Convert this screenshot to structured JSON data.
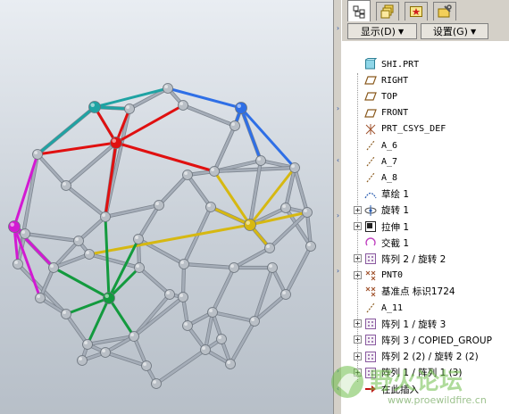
{
  "panel": {
    "tabs": [
      {
        "name": "model-tree-tab"
      },
      {
        "name": "layers-tab"
      },
      {
        "name": "favorites-tab"
      },
      {
        "name": "properties-tab"
      }
    ],
    "show_label": "显示(D)",
    "settings_label": "设置(G)"
  },
  "tree": {
    "items": [
      {
        "label": "SHI.PRT",
        "icon": "part-icon",
        "expandable": false
      },
      {
        "label": "RIGHT",
        "icon": "datum-plane-icon",
        "expandable": false
      },
      {
        "label": "TOP",
        "icon": "datum-plane-icon",
        "expandable": false
      },
      {
        "label": "FRONT",
        "icon": "datum-plane-icon",
        "expandable": false
      },
      {
        "label": "PRT_CSYS_DEF",
        "icon": "csys-icon",
        "expandable": false
      },
      {
        "label": "A_6",
        "icon": "datum-axis-icon",
        "expandable": false
      },
      {
        "label": "A_7",
        "icon": "datum-axis-icon",
        "expandable": false
      },
      {
        "label": "A_8",
        "icon": "datum-axis-icon",
        "expandable": false
      },
      {
        "label": "草绘 1",
        "icon": "sketch-icon",
        "expandable": false
      },
      {
        "label": "旋转 1",
        "icon": "revolve-icon",
        "expandable": true
      },
      {
        "label": "拉伸 1",
        "icon": "extrude-icon",
        "expandable": true
      },
      {
        "label": "交截 1",
        "icon": "intersect-icon",
        "expandable": false
      },
      {
        "label": "阵列 2 / 旋转 2",
        "icon": "pattern-icon",
        "expandable": true
      },
      {
        "label": "PNT0",
        "icon": "datum-point-icon",
        "expandable": true
      },
      {
        "label": "基准点 标识1724",
        "icon": "datum-point-icon",
        "expandable": false
      },
      {
        "label": "A_11",
        "icon": "datum-axis-icon",
        "expandable": false
      },
      {
        "label": "阵列 1 / 旋转 3",
        "icon": "pattern-icon",
        "expandable": true
      },
      {
        "label": "阵列 3 / COPIED_GROUP",
        "icon": "pattern-icon",
        "expandable": true
      },
      {
        "label": "阵列 2 (2) / 旋转 2 (2)",
        "icon": "pattern-icon",
        "expandable": true
      },
      {
        "label": "阵列 1 / 阵列 1 (3)",
        "icon": "pattern-icon",
        "expandable": true
      },
      {
        "label": "在此插入",
        "icon": "insert-here-arrow-icon",
        "expandable": false
      }
    ]
  },
  "colors": {
    "strut": "#a5adb8",
    "node": "#b9bfc6",
    "red": "#e01010",
    "blue": "#2f6fe6",
    "teal": "#1fa3a3",
    "magenta": "#d21ad2",
    "green": "#139a3e",
    "yellow": "#d6b812"
  },
  "watermark": {
    "text": "野火论坛",
    "url": "www.proewildfire.cn"
  }
}
